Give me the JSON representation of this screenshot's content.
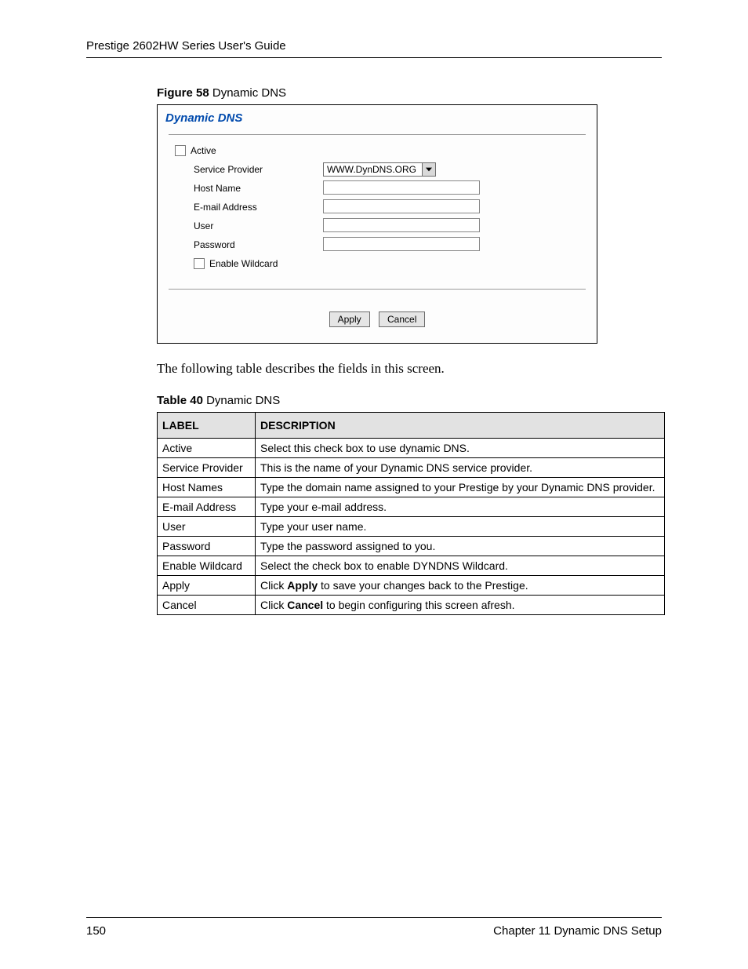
{
  "header": {
    "running": "Prestige 2602HW Series User's Guide"
  },
  "figure": {
    "caption_bold": "Figure 58",
    "caption_rest": "   Dynamic DNS",
    "panel_title": "Dynamic DNS",
    "rows": {
      "active_label": "Active",
      "service_provider_label": "Service Provider",
      "service_provider_value": "WWW.DynDNS.ORG",
      "host_name_label": "Host Name",
      "email_label": "E-mail Address",
      "user_label": "User",
      "password_label": "Password",
      "enable_wildcard_label": "Enable Wildcard"
    },
    "buttons": {
      "apply": "Apply",
      "cancel": "Cancel"
    }
  },
  "intro_text": "The following table describes the fields in this screen.",
  "table": {
    "caption_bold": "Table 40",
    "caption_rest": "   Dynamic DNS",
    "headers": {
      "label": "LABEL",
      "description": "DESCRIPTION"
    },
    "rows": [
      {
        "label": "Active",
        "desc": "Select this check box to use dynamic DNS."
      },
      {
        "label": "Service Provider",
        "desc": "This is the name of your Dynamic DNS service provider."
      },
      {
        "label": "Host Names",
        "desc": "Type the domain name assigned to your Prestige by your Dynamic DNS provider."
      },
      {
        "label": "E-mail Address",
        "desc": "Type your e-mail address."
      },
      {
        "label": "User",
        "desc": "Type your user name."
      },
      {
        "label": "Password",
        "desc": "Type the password assigned to you."
      },
      {
        "label": "Enable Wildcard",
        "desc": "Select the check box to enable DYNDNS Wildcard."
      },
      {
        "label": "Apply",
        "desc_pre": "Click ",
        "desc_bold": "Apply",
        "desc_post": " to save your changes back to the Prestige."
      },
      {
        "label": "Cancel",
        "desc_pre": "Click ",
        "desc_bold": "Cancel",
        "desc_post": " to begin configuring this screen afresh."
      }
    ]
  },
  "footer": {
    "page_number": "150",
    "chapter": "Chapter 11 Dynamic DNS Setup"
  }
}
